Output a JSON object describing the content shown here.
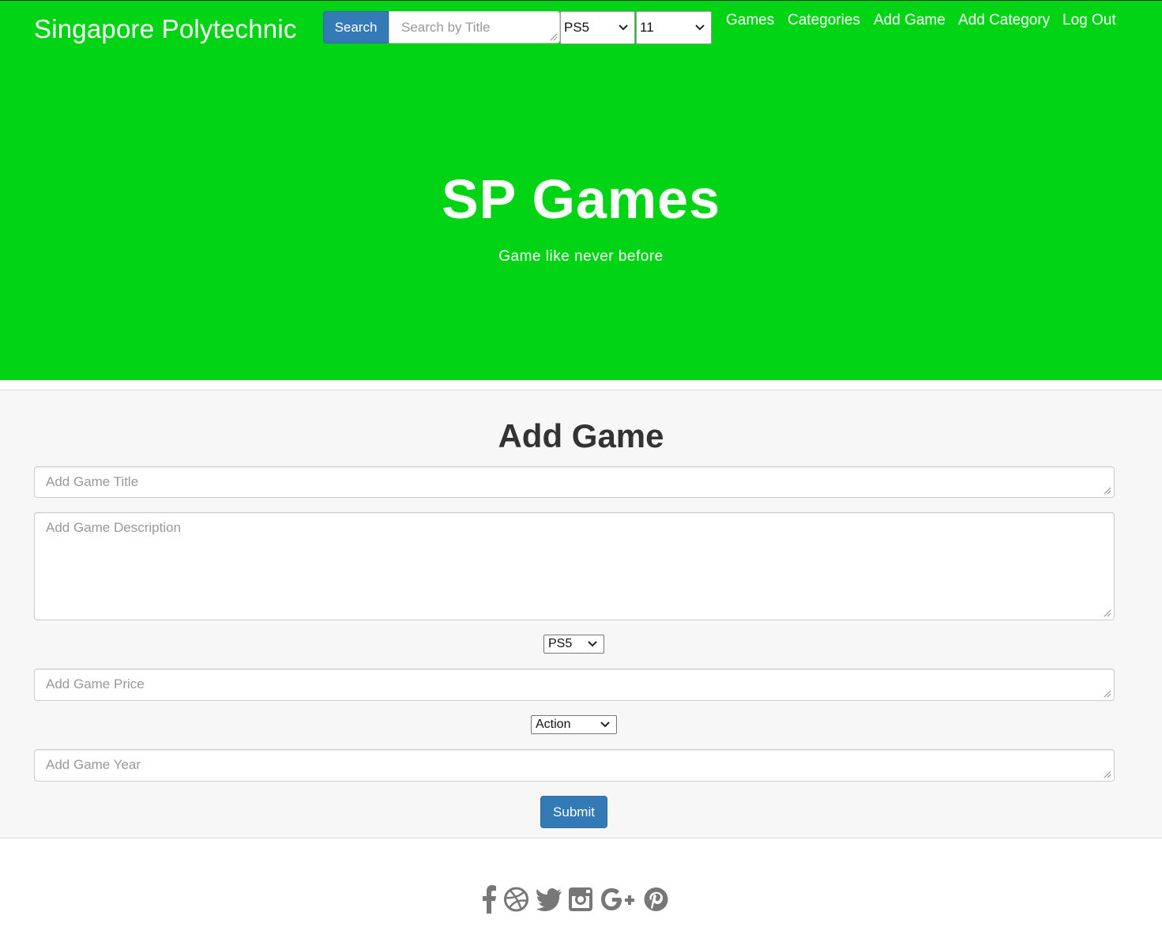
{
  "header": {
    "brand": "Singapore Polytechnic",
    "search_button": "Search",
    "search_placeholder": "Search by Title",
    "platform_select": "PS5",
    "number_select": "11",
    "nav": [
      "Games",
      "Categories",
      "Add Game",
      "Add Category",
      "Log Out"
    ]
  },
  "hero": {
    "title": "SP Games",
    "subtitle": "Game like never before"
  },
  "form": {
    "title": "Add Game",
    "title_placeholder": "Add Game Title",
    "description_placeholder": "Add Game Description",
    "platform_select": "PS5",
    "price_placeholder": "Add Game Price",
    "category_select": "Action",
    "year_placeholder": "Add Game Year",
    "submit": "Submit"
  },
  "footer": {
    "social_icons": [
      "facebook-icon",
      "dribbble-icon",
      "twitter-icon",
      "instagram-icon",
      "google-plus-icon",
      "pinterest-icon"
    ]
  },
  "colors": {
    "hero_bg": "#00d414",
    "primary_button": "#337ab7",
    "form_bg": "#f7f7f7",
    "icon_gray": "#777777"
  }
}
